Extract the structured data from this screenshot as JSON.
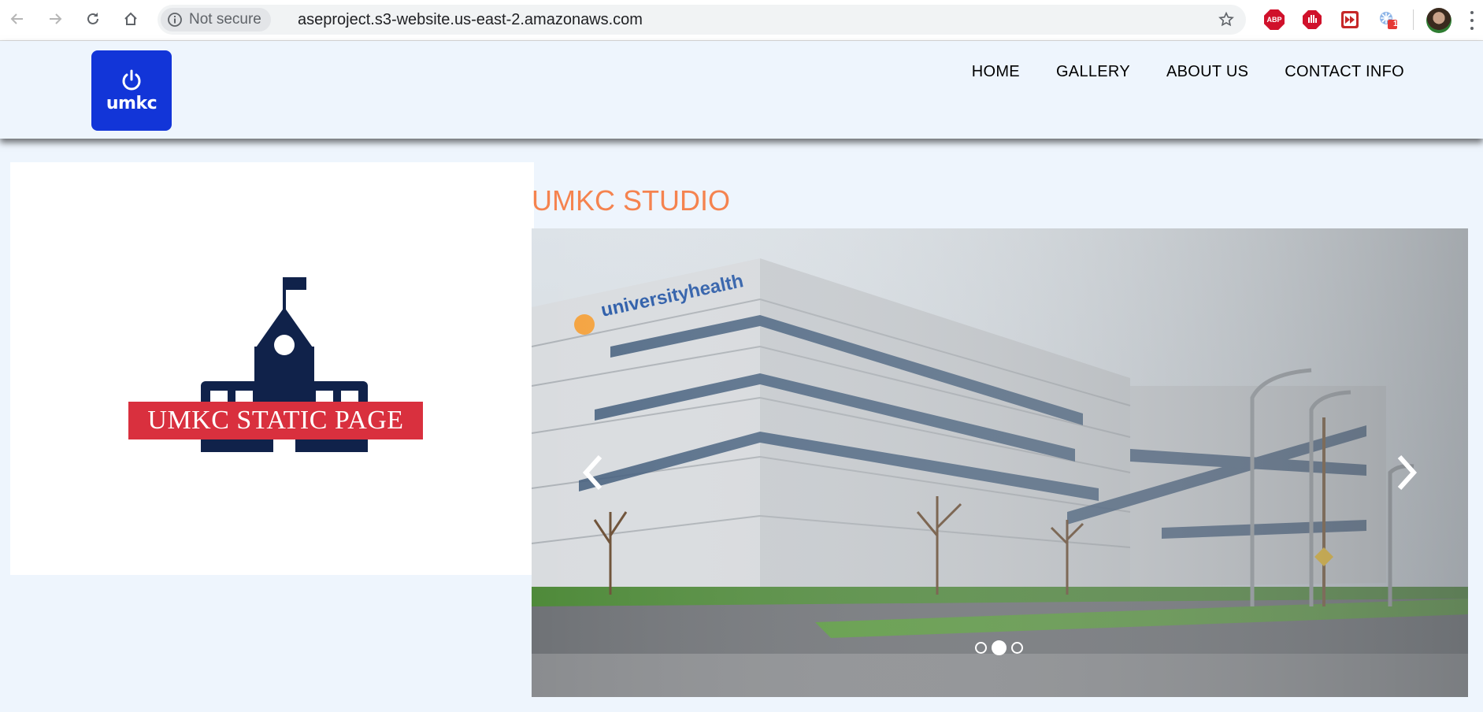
{
  "browser": {
    "security_label": "Not secure",
    "url": "aseproject.s3-website.us-east-2.amazonaws.com",
    "extensions": [
      {
        "icon": "adblock-plus-icon",
        "label": "ABP"
      },
      {
        "icon": "stop-hand-icon"
      },
      {
        "icon": "fast-forward-icon"
      },
      {
        "icon": "snowflake-extension-icon",
        "badge": "1"
      }
    ]
  },
  "site": {
    "logo_text": "umkc",
    "nav": [
      "HOME",
      "GALLERY",
      "ABOUT US",
      "CONTACT INFO"
    ],
    "banner_text": "UMKC STATIC PAGE",
    "studio_title": "UMKC STUDIO",
    "carousel": {
      "building_sign": "universityhealth",
      "slide_count": 3,
      "active_slide": 2
    }
  },
  "colors": {
    "page_bg": "#eef5fd",
    "logo_blue": "#1235d8",
    "banner_red": "#d9303e",
    "school_navy": "#10224a",
    "title_orange": "#f5834f"
  }
}
